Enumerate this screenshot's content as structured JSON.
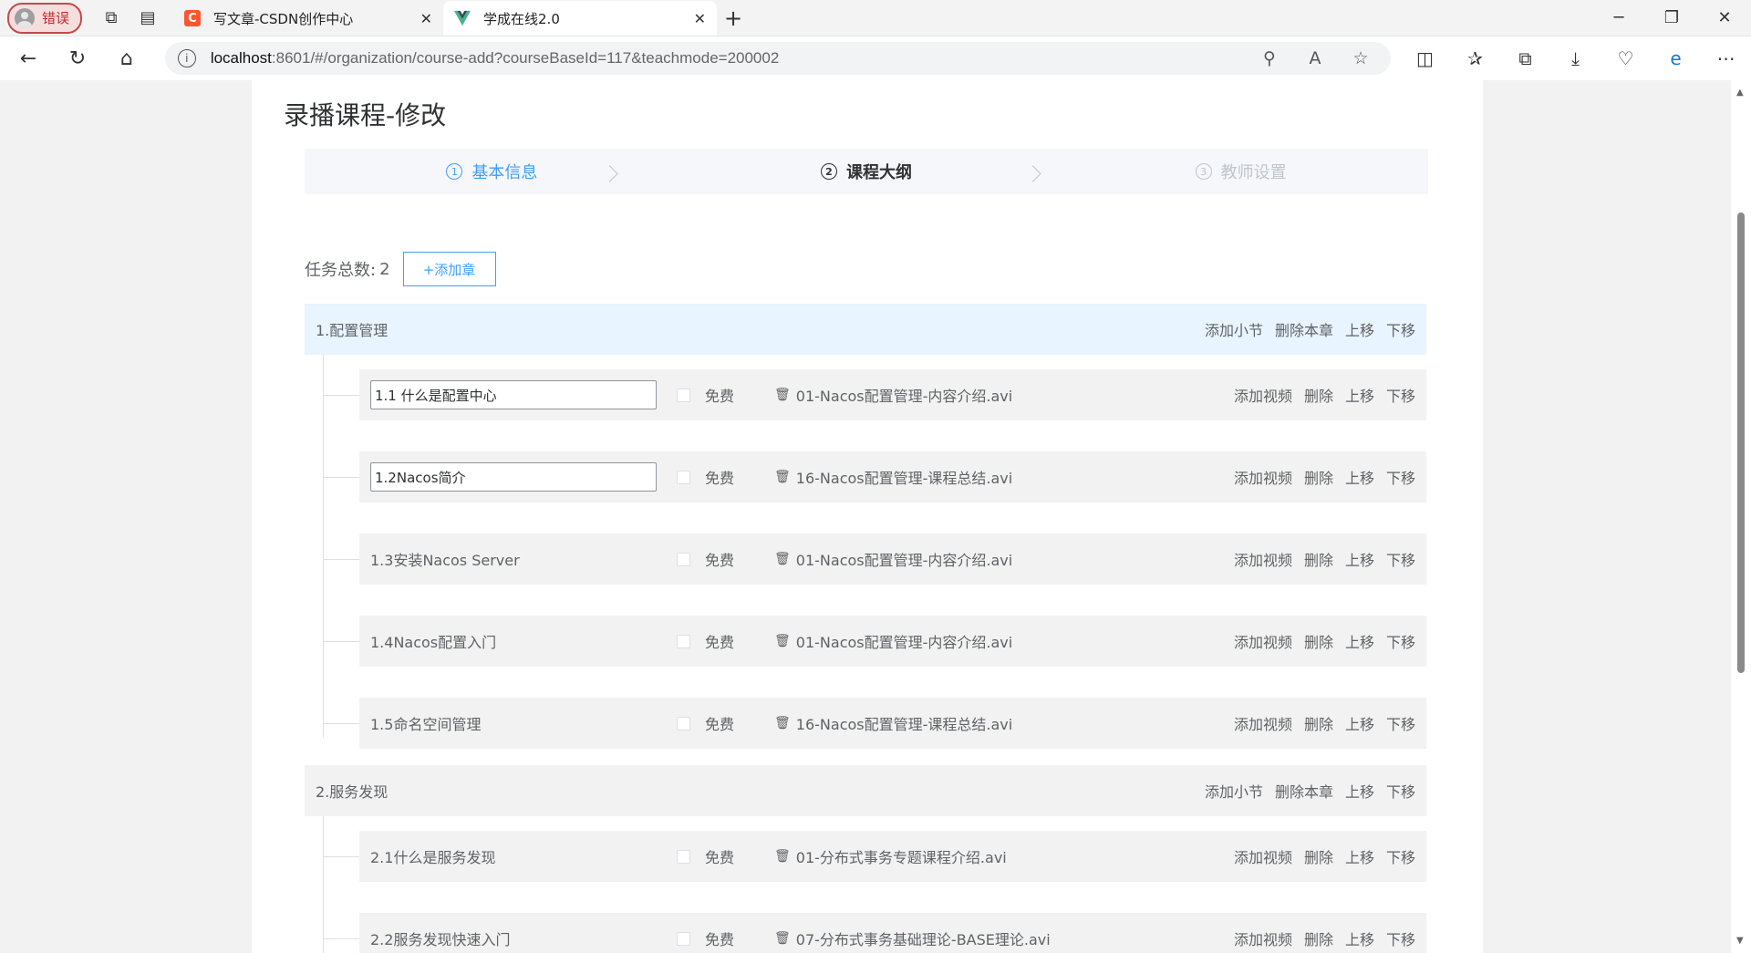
{
  "browser": {
    "profile_label": "错误",
    "tabs": [
      {
        "title": "写文章-CSDN创作中心"
      },
      {
        "title": "学成在线2.0"
      }
    ],
    "url_host": "localhost",
    "url_rest": ":8601/#/organization/course-add?courseBaseId=117&teachmode=200002"
  },
  "page": {
    "title": "录播课程-修改",
    "steps": [
      {
        "num": "1",
        "label": "基本信息"
      },
      {
        "num": "2",
        "label": "课程大纲"
      },
      {
        "num": "3",
        "label": "教师设置"
      }
    ],
    "task_label": "任务总数:",
    "task_count": "2",
    "add_chapter_label": "+添加章",
    "chapter_ops": [
      "添加小节",
      "删除本章",
      "上移",
      "下移"
    ],
    "section_ops": [
      "添加视频",
      "删除",
      "上移",
      "下移"
    ],
    "free_label": "免费",
    "chapters": [
      {
        "name": "1.配置管理",
        "sections": [
          {
            "name": "1.1 什么是配置中心",
            "editing": true,
            "video": "01-Nacos配置管理-内容介绍.avi"
          },
          {
            "name": "1.2Nacos简介",
            "editing": true,
            "video": "16-Nacos配置管理-课程总结.avi"
          },
          {
            "name": "1.3安装Nacos Server",
            "editing": false,
            "video": "01-Nacos配置管理-内容介绍.avi"
          },
          {
            "name": "1.4Nacos配置入门",
            "editing": false,
            "video": "01-Nacos配置管理-内容介绍.avi"
          },
          {
            "name": "1.5命名空间管理",
            "editing": false,
            "video": "16-Nacos配置管理-课程总结.avi"
          }
        ]
      },
      {
        "name": "2.服务发现",
        "sections": [
          {
            "name": "2.1什么是服务发现",
            "editing": false,
            "video": "01-分布式事务专题课程介绍.avi"
          },
          {
            "name": "2.2服务发现快速入门",
            "editing": false,
            "video": "07-分布式事务基础理论-BASE理论.avi"
          }
        ]
      }
    ]
  }
}
